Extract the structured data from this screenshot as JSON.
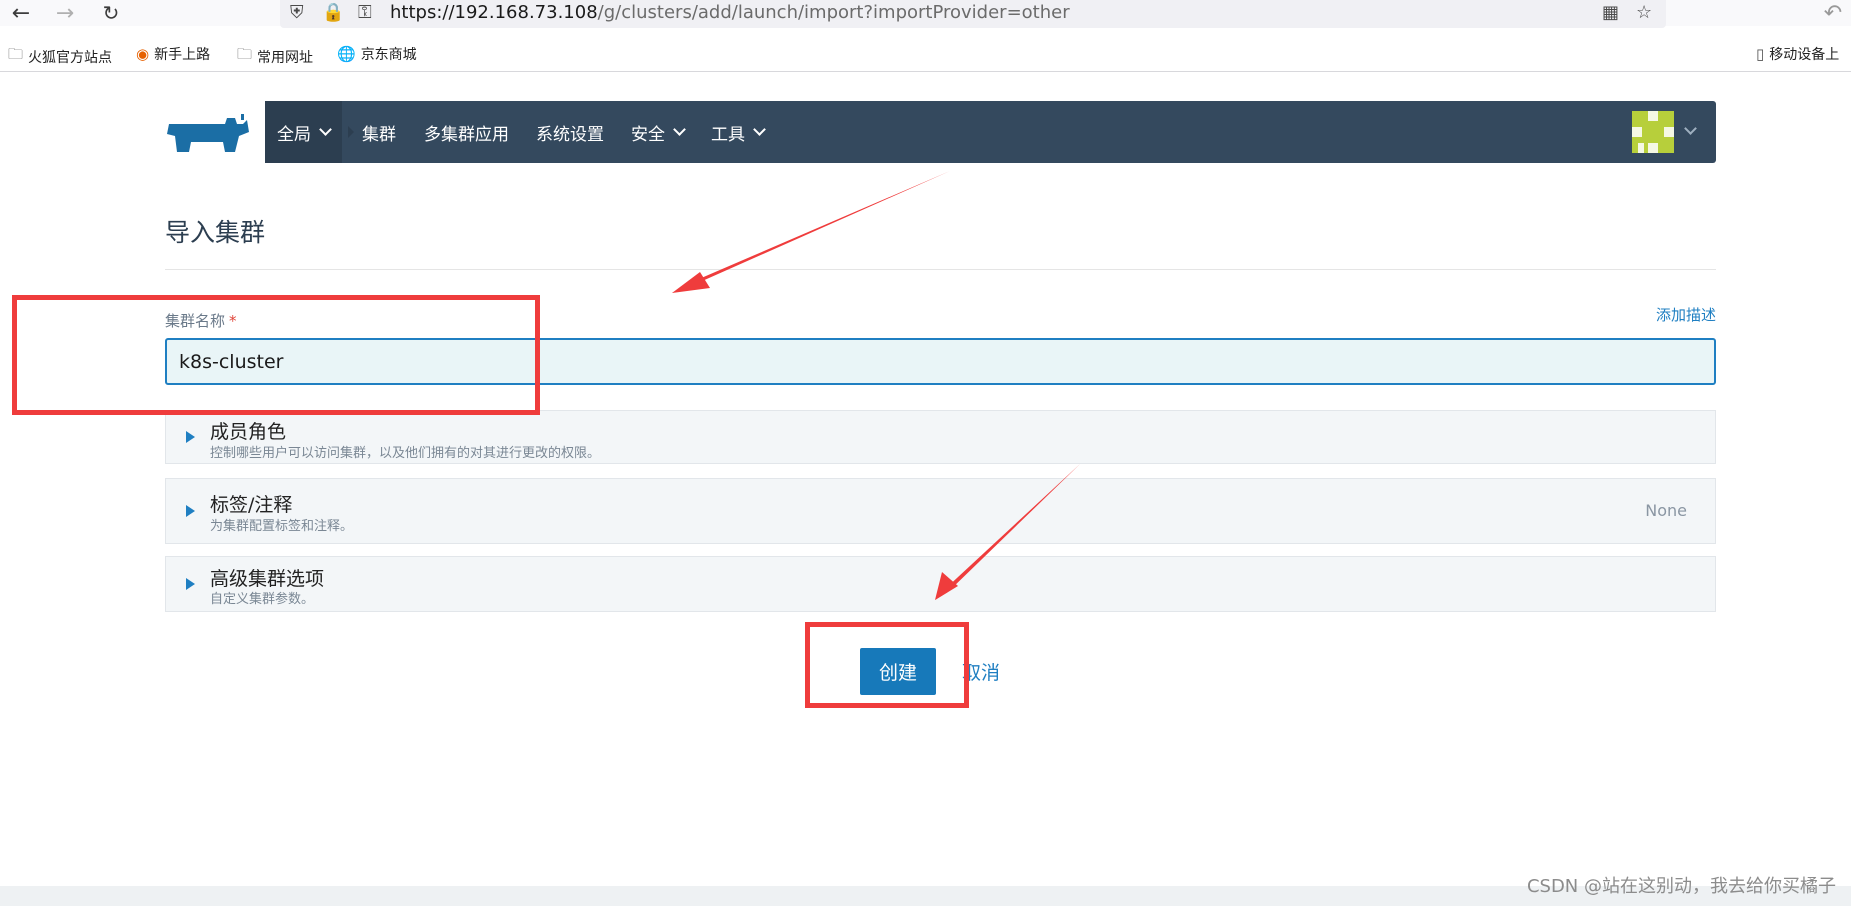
{
  "browser": {
    "url_host": "https://192.168.73.108",
    "url_path": "/g/clusters/add/launch/import?importProvider=other",
    "bookmarks": [
      "火狐官方站点",
      "新手上路",
      "常用网址",
      "京东商城"
    ],
    "mobile_bookmarks": "移动设备上"
  },
  "nav": {
    "global": "全局",
    "clusters": "集群",
    "multi_cluster_apps": "多集群应用",
    "settings": "系统设置",
    "security": "安全",
    "tools": "工具"
  },
  "page": {
    "title": "导入集群",
    "name_label": "集群名称",
    "required_mark": "*",
    "add_description": "添加描述",
    "cluster_name_value": "k8s-cluster"
  },
  "sections": [
    {
      "title": "成员角色",
      "subtitle": "控制哪些用户可以访问集群，以及他们拥有的对其进行更改的权限。",
      "right": ""
    },
    {
      "title": "标签/注释",
      "subtitle": "为集群配置标签和注释。",
      "right": "None"
    },
    {
      "title": "高级集群选项",
      "subtitle": "自定义集群参数。",
      "right": ""
    }
  ],
  "actions": {
    "create": "创建",
    "cancel": "取消"
  },
  "watermark": "CSDN @站在这别动，我去给你买橘子",
  "colors": {
    "nav_bg": "#34495e",
    "accent": "#1779ba",
    "annotation": "#ef3c3c"
  }
}
